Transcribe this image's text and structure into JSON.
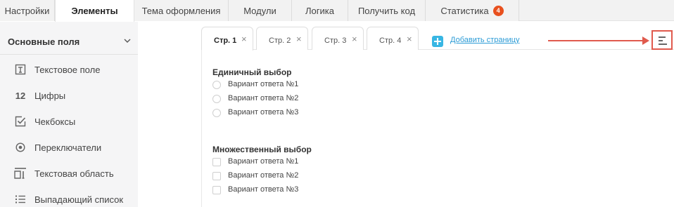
{
  "top_tabs": [
    {
      "label": "Настройки"
    },
    {
      "label": "Элементы",
      "active": true
    },
    {
      "label": "Тема оформления"
    },
    {
      "label": "Модули"
    },
    {
      "label": "Логика"
    },
    {
      "label": "Получить код"
    },
    {
      "label": "Статистика",
      "badge": "4"
    }
  ],
  "sidebar": {
    "section_title": "Основные поля",
    "items": [
      {
        "icon": "text-field-icon",
        "label": "Текстовое поле"
      },
      {
        "icon": "numbers-icon",
        "icon_text": "12",
        "label": "Цифры"
      },
      {
        "icon": "checkbox-icon",
        "label": "Чекбоксы"
      },
      {
        "icon": "radio-icon",
        "label": "Переключатели"
      },
      {
        "icon": "textarea-icon",
        "label": "Текстовая область"
      },
      {
        "icon": "list-icon",
        "label": "Выпадающий список"
      }
    ]
  },
  "page_tabs": [
    {
      "label": "Стр. 1",
      "active": true
    },
    {
      "label": "Стр. 2"
    },
    {
      "label": "Стр. 3"
    },
    {
      "label": "Стр. 4"
    }
  ],
  "page_tab_close": "×",
  "add_page": {
    "label": "Добавить страницу"
  },
  "colors": {
    "accent": "#2b9bd6",
    "badge": "#e8501e",
    "highlight": "#e05a4d"
  },
  "questions": [
    {
      "title": "Единичный выбор",
      "type": "radio",
      "options": [
        "Вариант ответа №1",
        "Вариант ответа №2",
        "Вариант ответа №3"
      ]
    },
    {
      "title": "Множественный выбор",
      "type": "checkbox",
      "options": [
        "Вариант ответа №1",
        "Вариант ответа №2",
        "Вариант ответа №3"
      ]
    }
  ]
}
